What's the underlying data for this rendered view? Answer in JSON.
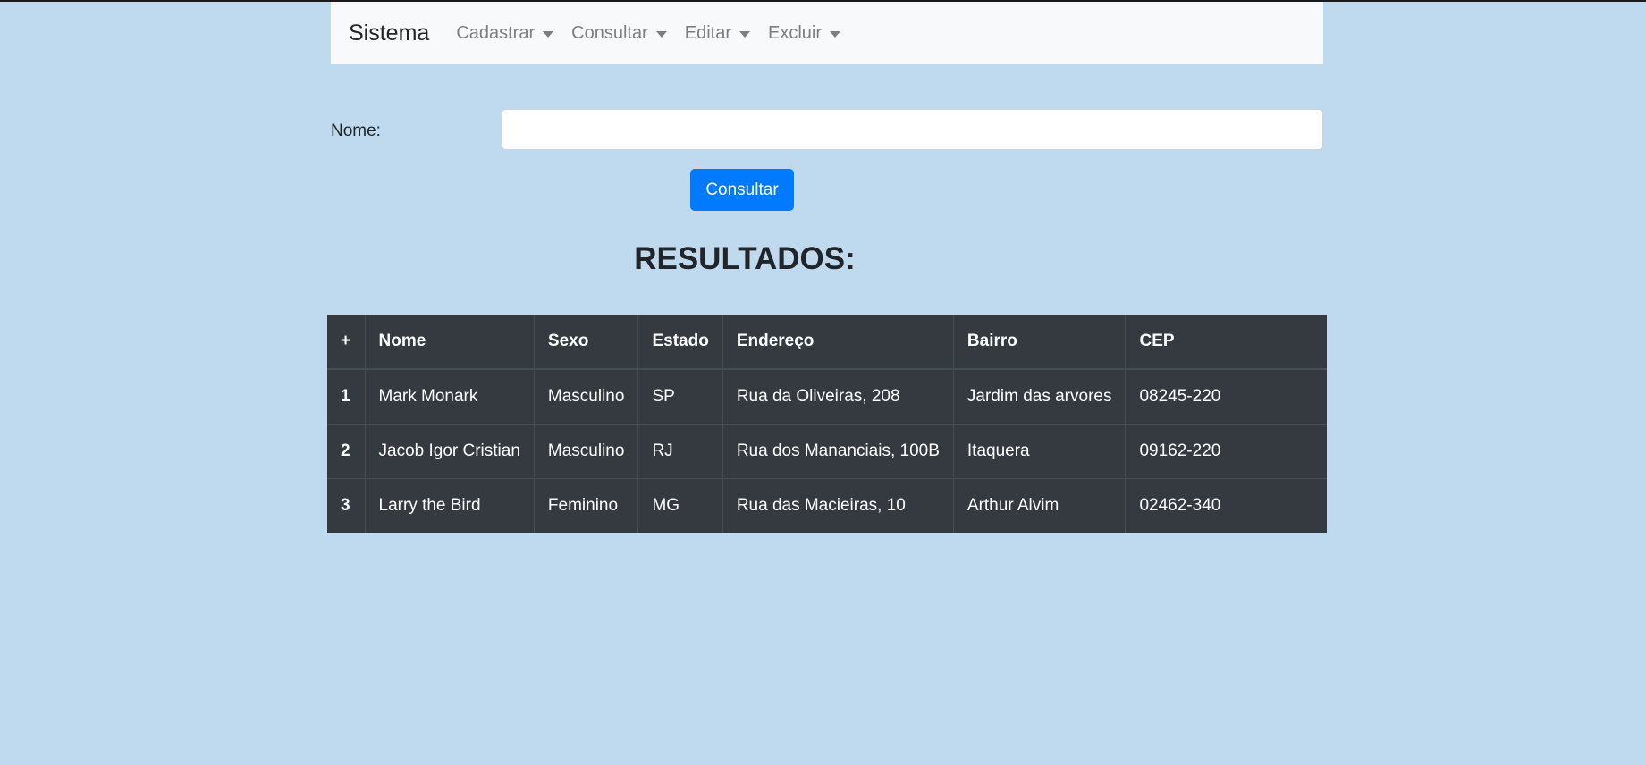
{
  "navbar": {
    "brand": "Sistema",
    "items": [
      {
        "label": "Cadastrar"
      },
      {
        "label": "Consultar"
      },
      {
        "label": "Editar"
      },
      {
        "label": "Excluir"
      }
    ]
  },
  "form": {
    "name_label": "Nome:",
    "name_value": "",
    "name_placeholder": "",
    "submit_label": "Consultar"
  },
  "results": {
    "title": "RESULTADOS:",
    "columns": [
      "+",
      "Nome",
      "Sexo",
      "Estado",
      "Endereço",
      "Bairro",
      "CEP"
    ],
    "rows": [
      {
        "id": "1",
        "nome": "Mark Monark",
        "sexo": "Masculino",
        "estado": "SP",
        "endereco": "Rua da Oliveiras, 208",
        "bairro": "Jardim das arvores",
        "cep": "08245-220"
      },
      {
        "id": "2",
        "nome": "Jacob Igor Cristian",
        "sexo": "Masculino",
        "estado": "RJ",
        "endereco": "Rua dos Mananciais, 100B",
        "bairro": "Itaquera",
        "cep": "09162-220"
      },
      {
        "id": "3",
        "nome": "Larry the Bird",
        "sexo": "Feminino",
        "estado": "MG",
        "endereco": "Rua das Macieiras, 10",
        "bairro": "Arthur Alvim",
        "cep": "02462-340"
      }
    ]
  },
  "colors": {
    "page_background": "#bfd9ee",
    "navbar_background": "#f8f9fa",
    "primary_button": "#007bff",
    "table_background": "#343a40"
  }
}
